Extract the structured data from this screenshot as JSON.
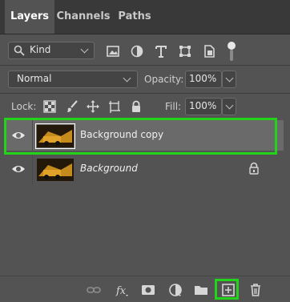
{
  "tabs": [
    {
      "label": "Layers",
      "active": true
    },
    {
      "label": "Channels",
      "active": false
    },
    {
      "label": "Paths",
      "active": false
    }
  ],
  "filter": {
    "kind_value": "Kind",
    "filter_icons": [
      "image-filter-icon",
      "adjustment-filter-icon",
      "type-filter-icon",
      "shape-filter-icon",
      "smart-object-filter-icon"
    ]
  },
  "blend": {
    "mode": "Normal",
    "opacity_label": "Opacity:",
    "opacity_value": "100%"
  },
  "lock": {
    "label": "Lock:",
    "fill_label": "Fill:",
    "fill_value": "100%"
  },
  "layers": [
    {
      "name": "Background copy",
      "selected": true,
      "italic": false,
      "locked": false
    },
    {
      "name": "Background",
      "selected": false,
      "italic": true,
      "locked": true
    }
  ],
  "colors": {
    "panel_bg": "#535353",
    "tab_bg": "#393939",
    "highlight": "#22d31a",
    "selected_row": "#6a6a6a"
  }
}
